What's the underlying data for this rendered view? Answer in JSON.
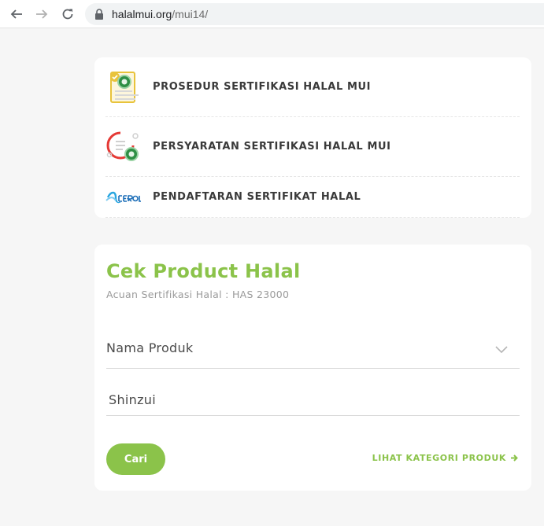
{
  "browser": {
    "url_domain": "halalmui.org",
    "url_path": "/mui14/"
  },
  "menu": {
    "items": [
      {
        "label": "PROSEDUR SERTIFIKASI HALAL MUI",
        "icon": "certificate-procedure-icon"
      },
      {
        "label": "PERSYARATAN SERTIFIKASI HALAL MUI",
        "icon": "certificate-requirements-icon"
      },
      {
        "label": "PENDAFTARAN SERTIFIKAT HALAL",
        "icon": "cerol-logo-icon"
      }
    ]
  },
  "check_product": {
    "title": "Cek Product Halal",
    "subtitle": "Acuan Sertifikasi Halal : HAS 23000",
    "select_value": "Nama Produk",
    "input_value": "Shinzui",
    "search_button": "Cari",
    "category_link": "LIHAT KATEGORI PRODUK"
  },
  "colors": {
    "accent": "#8bc34a",
    "background": "#f6f6f6"
  }
}
